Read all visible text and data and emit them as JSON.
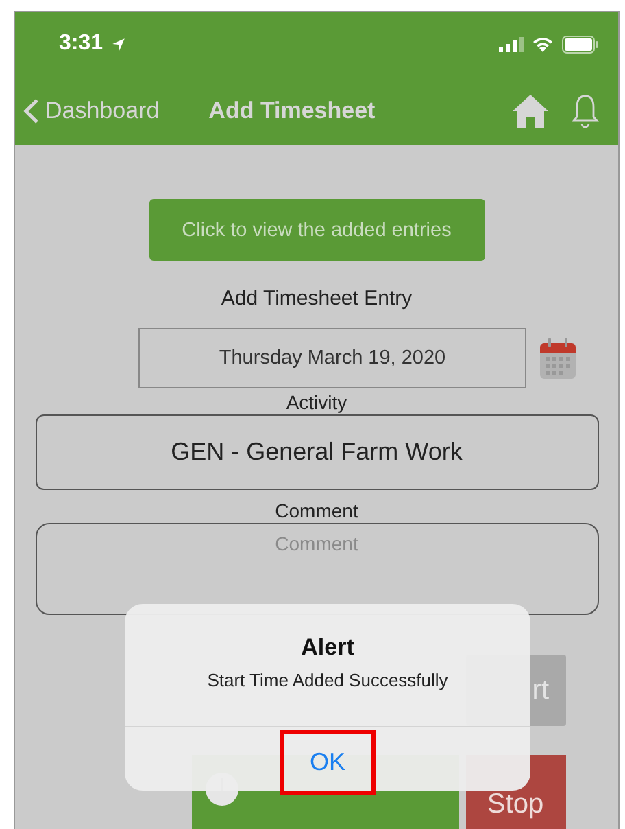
{
  "status_bar": {
    "time": "3:31"
  },
  "nav": {
    "back": "Dashboard",
    "title": "Add Timesheet"
  },
  "view_entries_button": "Click to view the added entries",
  "section_title": "Add Timesheet Entry",
  "date": "Thursday March 19, 2020",
  "activity": {
    "label": "Activity",
    "value": "GEN - General Farm Work"
  },
  "comment": {
    "label": "Comment",
    "placeholder": "Comment"
  },
  "start_button": "rt",
  "stop_button": "Stop",
  "alert": {
    "title": "Alert",
    "message": "Start Time Added Successfully",
    "button": "OK",
    "button_highlighted": true
  }
}
